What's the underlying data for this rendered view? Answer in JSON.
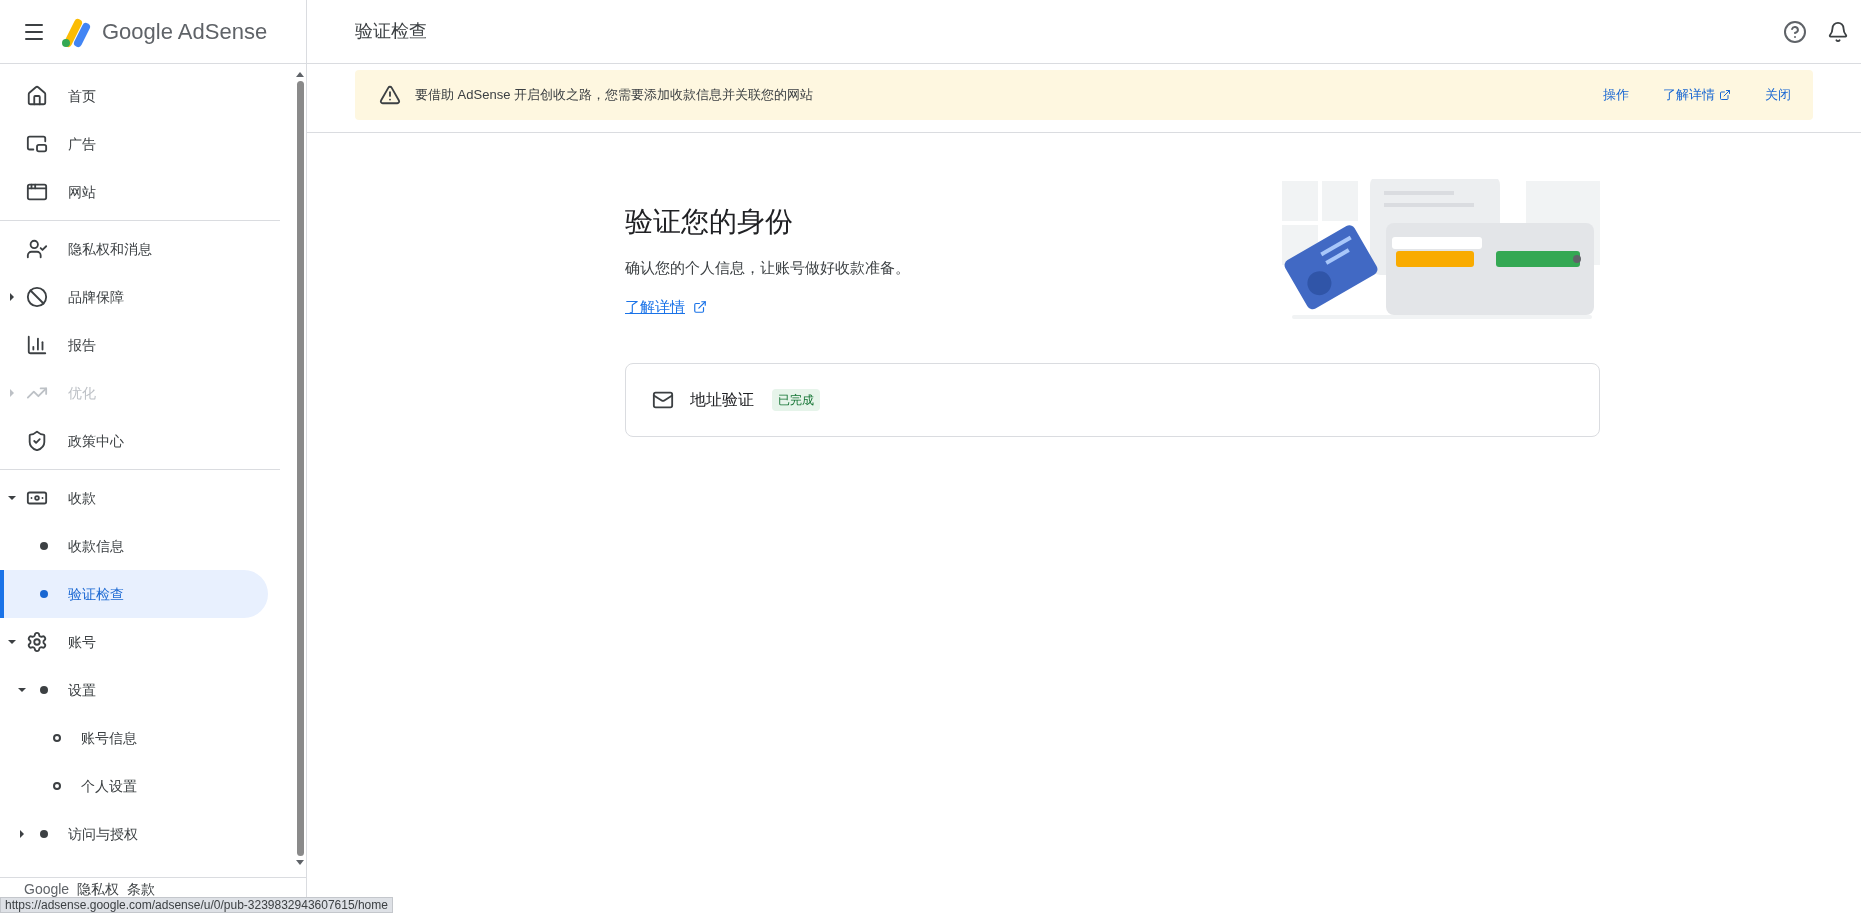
{
  "header": {
    "brand": "Google AdSense",
    "page_title": "验证检查"
  },
  "banner": {
    "message": "要借助 AdSense 开启创收之路，您需要添加收款信息并关联您的网站",
    "actions": [
      {
        "label": "操作",
        "external": false
      },
      {
        "label": "了解详情",
        "external": true
      },
      {
        "label": "关闭",
        "external": false
      }
    ]
  },
  "sidebar": {
    "groups": [
      [
        {
          "label": "首页",
          "selected": false,
          "disabled": false
        },
        {
          "label": "广告",
          "selected": false,
          "disabled": false
        },
        {
          "label": "网站",
          "selected": false,
          "disabled": false
        }
      ],
      [
        {
          "label": "隐私权和消息",
          "selected": false,
          "disabled": false
        },
        {
          "label": "品牌保障",
          "selected": false,
          "disabled": false,
          "expanded": false
        },
        {
          "label": "报告",
          "selected": false,
          "disabled": false
        },
        {
          "label": "优化",
          "selected": false,
          "disabled": true,
          "expanded": false
        },
        {
          "label": "政策中心",
          "selected": false,
          "disabled": false
        }
      ],
      [
        {
          "label": "收款",
          "selected": false,
          "disabled": false,
          "expanded": true,
          "children": [
            {
              "label": "收款信息",
              "selected": false,
              "disabled": false
            },
            {
              "label": "验证检查",
              "selected": true,
              "disabled": false
            }
          ]
        },
        {
          "label": "账号",
          "selected": false,
          "disabled": false,
          "expanded": true,
          "children": [
            {
              "label": "设置",
              "selected": false,
              "disabled": false,
              "expanded": true,
              "children": [
                {
                  "label": "账号信息",
                  "selected": false,
                  "disabled": false
                },
                {
                  "label": "个人设置",
                  "selected": false,
                  "disabled": false
                }
              ]
            },
            {
              "label": "访问与授权",
              "selected": false,
              "disabled": false,
              "expanded": false
            }
          ]
        }
      ]
    ],
    "footer": [
      "Google",
      "隐私权",
      "条款"
    ]
  },
  "status_url": "https://adsense.google.com/adsense/u/0/pub-3239832943607615/home",
  "main": {
    "title": "验证您的身份",
    "description": "确认您的个人信息，让账号做好收款准备。",
    "learn_more": "了解详情",
    "steps": [
      {
        "label": "地址验证",
        "status": "已完成",
        "done": true
      }
    ]
  }
}
